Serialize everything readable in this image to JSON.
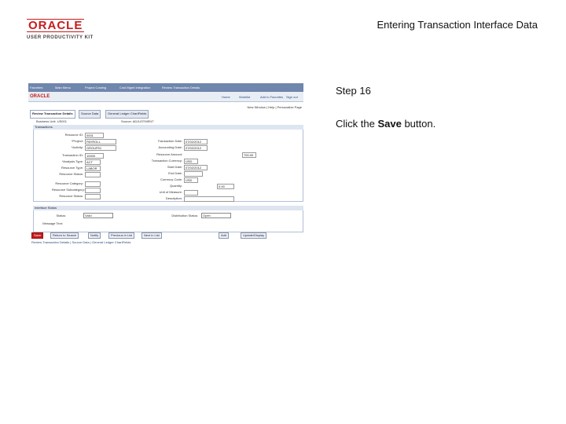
{
  "logo": {
    "brand": "ORACLE",
    "product": "USER PRODUCTIVITY KIT"
  },
  "doc_title": "Entering Transaction Interface Data",
  "step": "Step 16",
  "instruction": {
    "prefix": "Click the ",
    "bold": "Save",
    "suffix": " button."
  },
  "app": {
    "menu": [
      "Favorites",
      "Main Menu",
      "Project Costing",
      "Cost Mgmt Integration",
      "Review Transaction Details"
    ],
    "brand": "ORACLE",
    "links": [
      "Home",
      "Worklist",
      "Add to Favorites",
      "Sign out"
    ],
    "toolbar_links": "New Window | Help | Personalize Page",
    "tabs": [
      "Review Transaction Details",
      "Source Data",
      "General Ledger ChartFields"
    ],
    "header": {
      "bu_label": "Business Unit:",
      "bu_value": "US001",
      "src_label": "Source:",
      "src_value": "ADJUSTMENT"
    },
    "group_title": "Transactions",
    "left_fields": [
      {
        "label": "Resource ID:",
        "value": "0001"
      },
      {
        "label": "*Project:",
        "value": "PAYROLL"
      },
      {
        "label": "*Activity:",
        "value": "GROUP01"
      },
      {
        "label": "Transaction ID:",
        "value": "10000"
      },
      {
        "label": "*Analysis Type:",
        "value": "ACT"
      },
      {
        "label": "Resource Type:",
        "value": "LABOR"
      },
      {
        "label": "Resource Status:",
        "value": ""
      },
      {
        "label": "Resource Category:",
        "value": ""
      },
      {
        "label": "Resource Subcategory:",
        "value": ""
      },
      {
        "label": "Resource Status:",
        "value": ""
      }
    ],
    "right_fields": [
      {
        "label": "Transaction Date:",
        "value": "07/02/2012"
      },
      {
        "label": "Accounting Date:",
        "value": "07/02/2012"
      },
      {
        "label": "Resource Amount:",
        "value": "700.00"
      },
      {
        "label": "Transaction Currency:",
        "value": "USD"
      },
      {
        "label": "Start Date:",
        "value": "07/02/2012"
      },
      {
        "label": "End Date:",
        "value": ""
      },
      {
        "label": "Currency Code:",
        "value": "USD"
      },
      {
        "label": "Quantity:",
        "value": "0.00"
      },
      {
        "label": "Unit of Measure:",
        "value": ""
      },
      {
        "label": "Description:",
        "value": ""
      }
    ],
    "status_title": "Interface Status",
    "status_left_label": "Status:",
    "status_left_value": "Valid",
    "status_right_label": "Distribution Status:",
    "status_right_value": "Open",
    "message_label": "Message Text:",
    "buttons": {
      "save": "Save",
      "return": "Return to Search",
      "notify": "Notify",
      "previous": "Previous in List",
      "next": "Next in List",
      "refresh": "Refresh",
      "add": "Add",
      "update": "Update/Display"
    },
    "bottom_links": "Review Transaction Details | Source Data | General Ledger ChartFields"
  }
}
